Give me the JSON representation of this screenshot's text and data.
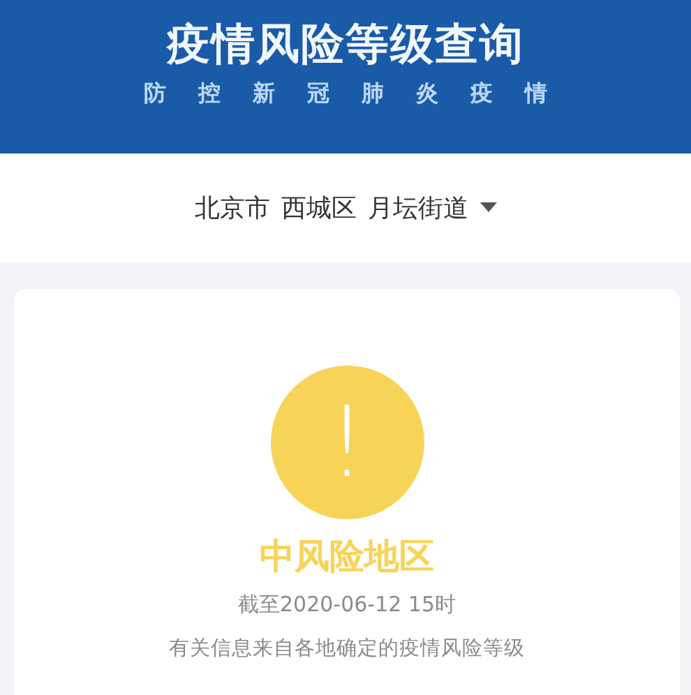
{
  "header": {
    "title": "疫情风险等级查询",
    "subtitle": "防控新冠肺炎疫情"
  },
  "location": {
    "parts": [
      "北京市",
      "西城区",
      "月坛街道"
    ]
  },
  "result": {
    "kind": "medium",
    "icon": "!",
    "label": "中风险地区",
    "updated": "截至2020-06-12 15时",
    "note": "有关信息来自各地确定的疫情风险等级"
  }
}
